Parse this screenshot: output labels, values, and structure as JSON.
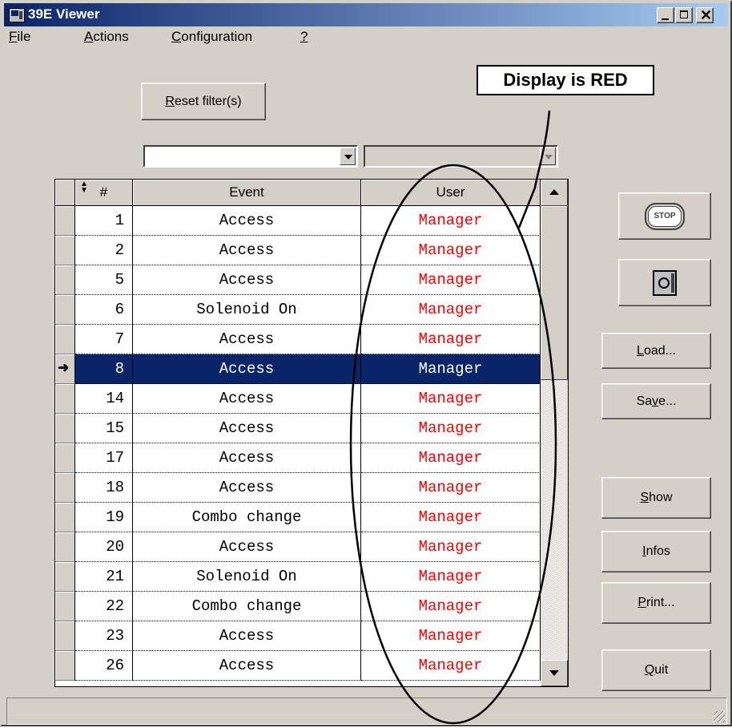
{
  "window": {
    "title": "39E Viewer"
  },
  "menu": [
    {
      "pre": "",
      "key": "F",
      "post": "ile"
    },
    {
      "pre": "",
      "key": "A",
      "post": "ctions"
    },
    {
      "pre": "",
      "key": "C",
      "post": "onfiguration"
    },
    {
      "pre": "",
      "key": "?",
      "post": ""
    }
  ],
  "reset_filter": {
    "key": "R",
    "rest": "eset filter(s)"
  },
  "annotation": {
    "text": "Display is RED"
  },
  "grid": {
    "headers": {
      "num": "#",
      "event": "Event",
      "user": "User"
    },
    "user_color": "#ff0000",
    "selected_color": "#0a246a",
    "selected_index": 5,
    "rows": [
      {
        "num": "1",
        "event": "Access",
        "user": "Manager"
      },
      {
        "num": "2",
        "event": "Access",
        "user": "Manager"
      },
      {
        "num": "5",
        "event": "Access",
        "user": "Manager"
      },
      {
        "num": "6",
        "event": "Solenoid On",
        "user": "Manager"
      },
      {
        "num": "7",
        "event": "Access",
        "user": "Manager"
      },
      {
        "num": "8",
        "event": "Access",
        "user": "Manager"
      },
      {
        "num": "14",
        "event": "Access",
        "user": "Manager"
      },
      {
        "num": "15",
        "event": "Access",
        "user": "Manager"
      },
      {
        "num": "17",
        "event": "Access",
        "user": "Manager"
      },
      {
        "num": "18",
        "event": "Access",
        "user": "Manager"
      },
      {
        "num": "19",
        "event": "Combo change",
        "user": "Manager"
      },
      {
        "num": "20",
        "event": "Access",
        "user": "Manager"
      },
      {
        "num": "21",
        "event": "Solenoid On",
        "user": "Manager"
      },
      {
        "num": "22",
        "event": "Combo change",
        "user": "Manager"
      },
      {
        "num": "23",
        "event": "Access",
        "user": "Manager"
      },
      {
        "num": "26",
        "event": "Access",
        "user": "Manager"
      }
    ]
  },
  "side_buttons": {
    "stop_icon_text": "STOP",
    "load": {
      "key": "L",
      "rest": "oad..."
    },
    "save": {
      "pre": "Sa",
      "key": "v",
      "rest": "e..."
    },
    "show": {
      "key": "S",
      "rest": "how"
    },
    "infos": {
      "key": "I",
      "rest": "nfos"
    },
    "print": {
      "key": "P",
      "rest": "rint..."
    },
    "quit": {
      "key": "Q",
      "rest": "uit"
    }
  }
}
